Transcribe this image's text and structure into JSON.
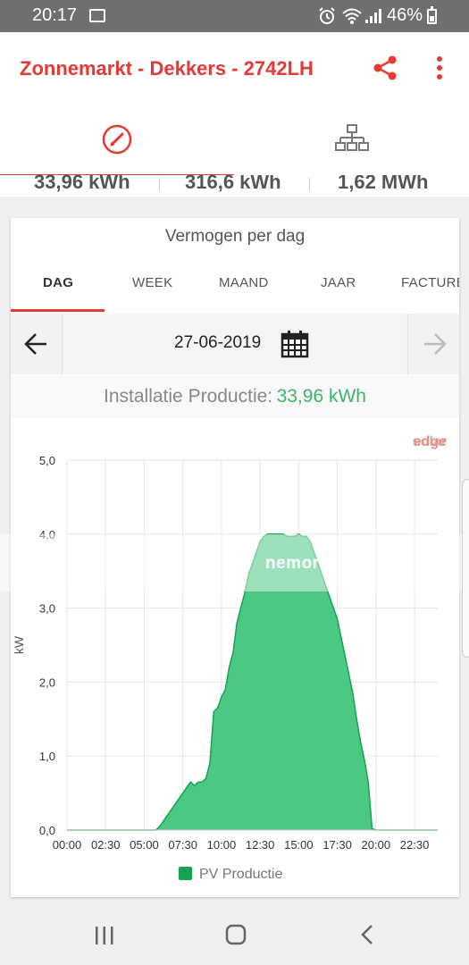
{
  "status": {
    "time": "20:17",
    "battery": "46%"
  },
  "app": {
    "title": "Zonnemarkt - Dekkers - 2742LH"
  },
  "totals": [
    "33,96 kWh",
    "316,6 kWh",
    "1,62 MWh"
  ],
  "card": {
    "title": "Vermogen per dag",
    "tabs": [
      "DAG",
      "WEEK",
      "MAAND",
      "JAAR",
      "FACTUREREN"
    ],
    "date": "27-06-2019",
    "summary_label": "Installatie Productie:",
    "summary_value": "33,96 kWh"
  },
  "watermark": {
    "brand": "solaredge",
    "overlay": "nemori"
  },
  "colors": {
    "accent": "#e53935",
    "series": "#17a24e",
    "value_green": "#3cb36a"
  },
  "chart_data": {
    "type": "area",
    "ylabel": "kW",
    "ylim": [
      0,
      5
    ],
    "yticks": [
      "0,0",
      "1,0",
      "2,0",
      "3,0",
      "4,0",
      "5,0"
    ],
    "xticks": [
      "00:00",
      "02:30",
      "05:00",
      "07:30",
      "10:00",
      "12:30",
      "15:00",
      "17:30",
      "20:00",
      "22:30"
    ],
    "xlim": [
      0,
      24
    ],
    "grid": true,
    "legend": "bottom",
    "series": [
      {
        "name": "PV Productie",
        "x": [
          0,
          5.75,
          6,
          6.5,
          7,
          7.5,
          8,
          8.25,
          8.5,
          8.75,
          9,
          9.25,
          9.5,
          9.75,
          10,
          10.25,
          10.5,
          10.75,
          11,
          11.25,
          11.5,
          11.75,
          12,
          12.25,
          12.5,
          12.75,
          13,
          13.25,
          13.5,
          13.75,
          14,
          14.25,
          14.5,
          14.75,
          15,
          15.25,
          15.5,
          15.75,
          16,
          16.25,
          16.5,
          16.75,
          17,
          17.25,
          17.5,
          17.75,
          18,
          18.25,
          18.5,
          18.75,
          19,
          19.25,
          19.5,
          19.75,
          20,
          20.25,
          24
        ],
        "values": [
          0,
          0,
          0.05,
          0.2,
          0.35,
          0.5,
          0.65,
          0.6,
          0.65,
          0.65,
          0.7,
          0.9,
          1.6,
          1.65,
          1.8,
          1.9,
          2.2,
          2.4,
          2.8,
          3.0,
          3.2,
          3.45,
          3.6,
          3.75,
          3.9,
          3.97,
          4.0,
          4.0,
          4.0,
          4.0,
          4.0,
          3.97,
          3.97,
          3.97,
          4.0,
          3.97,
          3.97,
          3.9,
          3.75,
          3.6,
          3.45,
          3.3,
          3.15,
          3.0,
          2.85,
          2.6,
          2.35,
          2.1,
          1.85,
          1.5,
          1.2,
          0.95,
          0.65,
          0.02,
          0,
          0,
          0
        ]
      }
    ]
  }
}
